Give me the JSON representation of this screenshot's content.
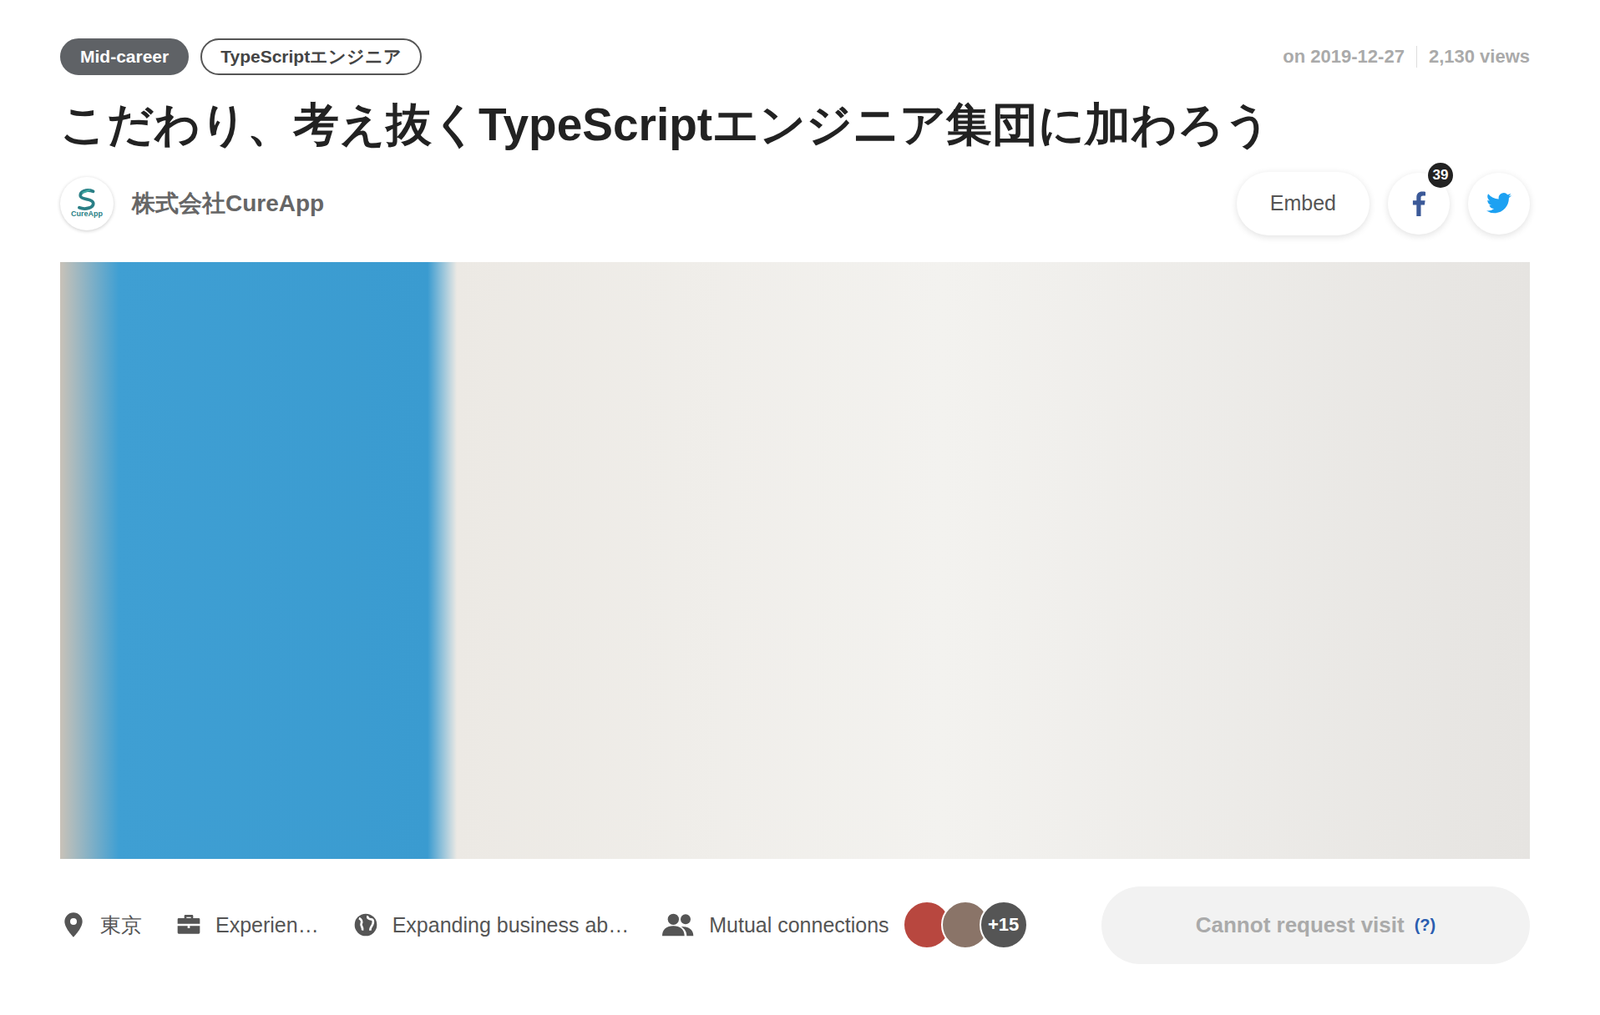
{
  "tags": [
    {
      "label": "Mid-career",
      "kind": "category"
    },
    {
      "label": "TypeScriptエンジニア",
      "kind": "tag"
    }
  ],
  "meta": {
    "date": "on 2019-12-27",
    "views": "2,130 views"
  },
  "title": "こだわり、考え抜くTypeScriptエンジニア集団に加わろう",
  "company": {
    "name": "株式会社CureApp",
    "logo_text": "CureApp"
  },
  "share": {
    "embed": "Embed",
    "facebook_count": "39"
  },
  "details": [
    {
      "kind": "location",
      "label": "東京"
    },
    {
      "kind": "job",
      "label": "Experien…"
    },
    {
      "kind": "business",
      "label": "Expanding business ab…"
    }
  ],
  "mutual": {
    "label": "Mutual connections",
    "more": "+15",
    "avatars": [
      {
        "color": "#b8473f"
      },
      {
        "color": "#8a7468"
      }
    ]
  },
  "visit_button": {
    "label": "Cannot request visit",
    "help": "(?)",
    "disabled": true
  }
}
